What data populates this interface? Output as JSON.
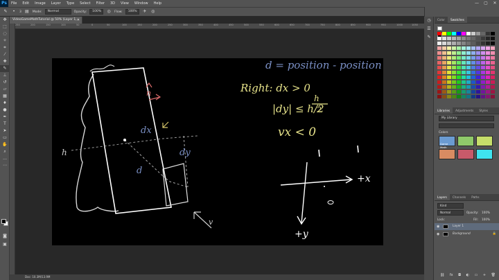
{
  "app": {
    "logo": "Ps"
  },
  "menubar": {
    "items": [
      "File",
      "Edit",
      "Image",
      "Layer",
      "Type",
      "Select",
      "Filter",
      "3D",
      "View",
      "Window",
      "Help"
    ],
    "controls": [
      "—",
      "▢",
      "✕"
    ]
  },
  "options": {
    "brush_size": "3",
    "mode_label": "Mode:",
    "mode_value": "Normal",
    "opacity_label": "Opacity:",
    "opacity_value": "100%",
    "flow_label": "Flow:",
    "flow_value": "100%",
    "workspace": "Essentials"
  },
  "document": {
    "tab_title": "VideoGameMathTutorial @ 50% (Layer 1, RGB/8) *",
    "status": "Doc: 10.3M/13.9M"
  },
  "ruler_ticks": [
    "250",
    "200",
    "150",
    "100",
    "50",
    "0",
    "50",
    "100",
    "150",
    "200",
    "250",
    "300",
    "350",
    "400",
    "450",
    "500",
    "550",
    "600",
    "650",
    "700",
    "750",
    "800",
    "850",
    "900",
    "950",
    "1000",
    "1050"
  ],
  "right_panels": {
    "color_tabs": [
      "Color",
      "Swatches"
    ],
    "library_tabs": [
      "Libraries",
      "Adjustments",
      "Styles"
    ],
    "library_select": "My Library",
    "colors_heading": "Colors",
    "color_tile_label": "Game Math",
    "layer_tabs": [
      "Layers",
      "Channels",
      "Paths"
    ],
    "kind_label": "Kind",
    "blend_mode": "Normal",
    "opacity_label": "Opacity:",
    "opacity_value": "100%",
    "lock_label": "Lock:",
    "fill_label": "Fill:",
    "fill_value": "100%",
    "layers": [
      {
        "name": "Layer 1",
        "selected": true
      },
      {
        "name": "Background",
        "selected": false
      }
    ]
  },
  "canvas_notes": {
    "line1": "d = position - position",
    "line2": "Right: dx > 0",
    "line3": "|dy| ≤ h/2",
    "line4": "vx < 0",
    "plus_x": "+x",
    "plus_y": "+y",
    "label_h": "h",
    "label_dx": "dx",
    "label_dy": "dy",
    "label_d": "d",
    "label_v": "v",
    "label_n": "n"
  },
  "tile_colors": [
    "#6b9bd1",
    "#8fc96a",
    "#c6de6a",
    "#d98b62",
    "#c85a6a",
    "#3fe4f0"
  ],
  "swatch_colors": [
    "#ff0000",
    "#ffff00",
    "#00ff00",
    "#00ffff",
    "#0000ff",
    "#ff00ff",
    "#ffffff",
    "#cccccc",
    "#999999",
    "#666666",
    "#333333",
    "#000000",
    "#ff6666",
    "#ffcc66",
    "#99ff66"
  ]
}
